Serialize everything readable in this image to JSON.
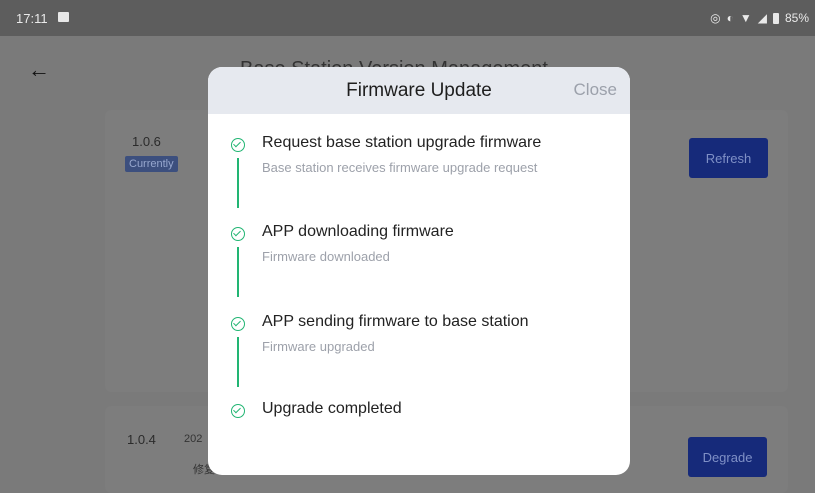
{
  "status_bar": {
    "time": "17:11",
    "battery": "85%"
  },
  "background": {
    "page_title": "Base Station Version Management",
    "versions": [
      {
        "version": "1.0.6",
        "badge": "Currently",
        "action": "Refresh"
      },
      {
        "version": "1.0.4",
        "date_fragment": "202",
        "note_fragment": "修复",
        "action": "Degrade"
      }
    ]
  },
  "modal": {
    "title": "Firmware Update",
    "close_label": "Close",
    "steps": [
      {
        "title": "Request base station upgrade firmware",
        "description": "Base station receives firmware upgrade request"
      },
      {
        "title": "APP downloading firmware",
        "description": "Firmware downloaded"
      },
      {
        "title": "APP sending firmware to base station",
        "description": "Firmware upgraded"
      },
      {
        "title": "Upgrade completed",
        "description": ""
      }
    ]
  },
  "colors": {
    "accent_green": "#22b573",
    "primary_button": "#162a7a"
  },
  "icons": {
    "back": "arrow-left",
    "step_status": "check-circle"
  }
}
